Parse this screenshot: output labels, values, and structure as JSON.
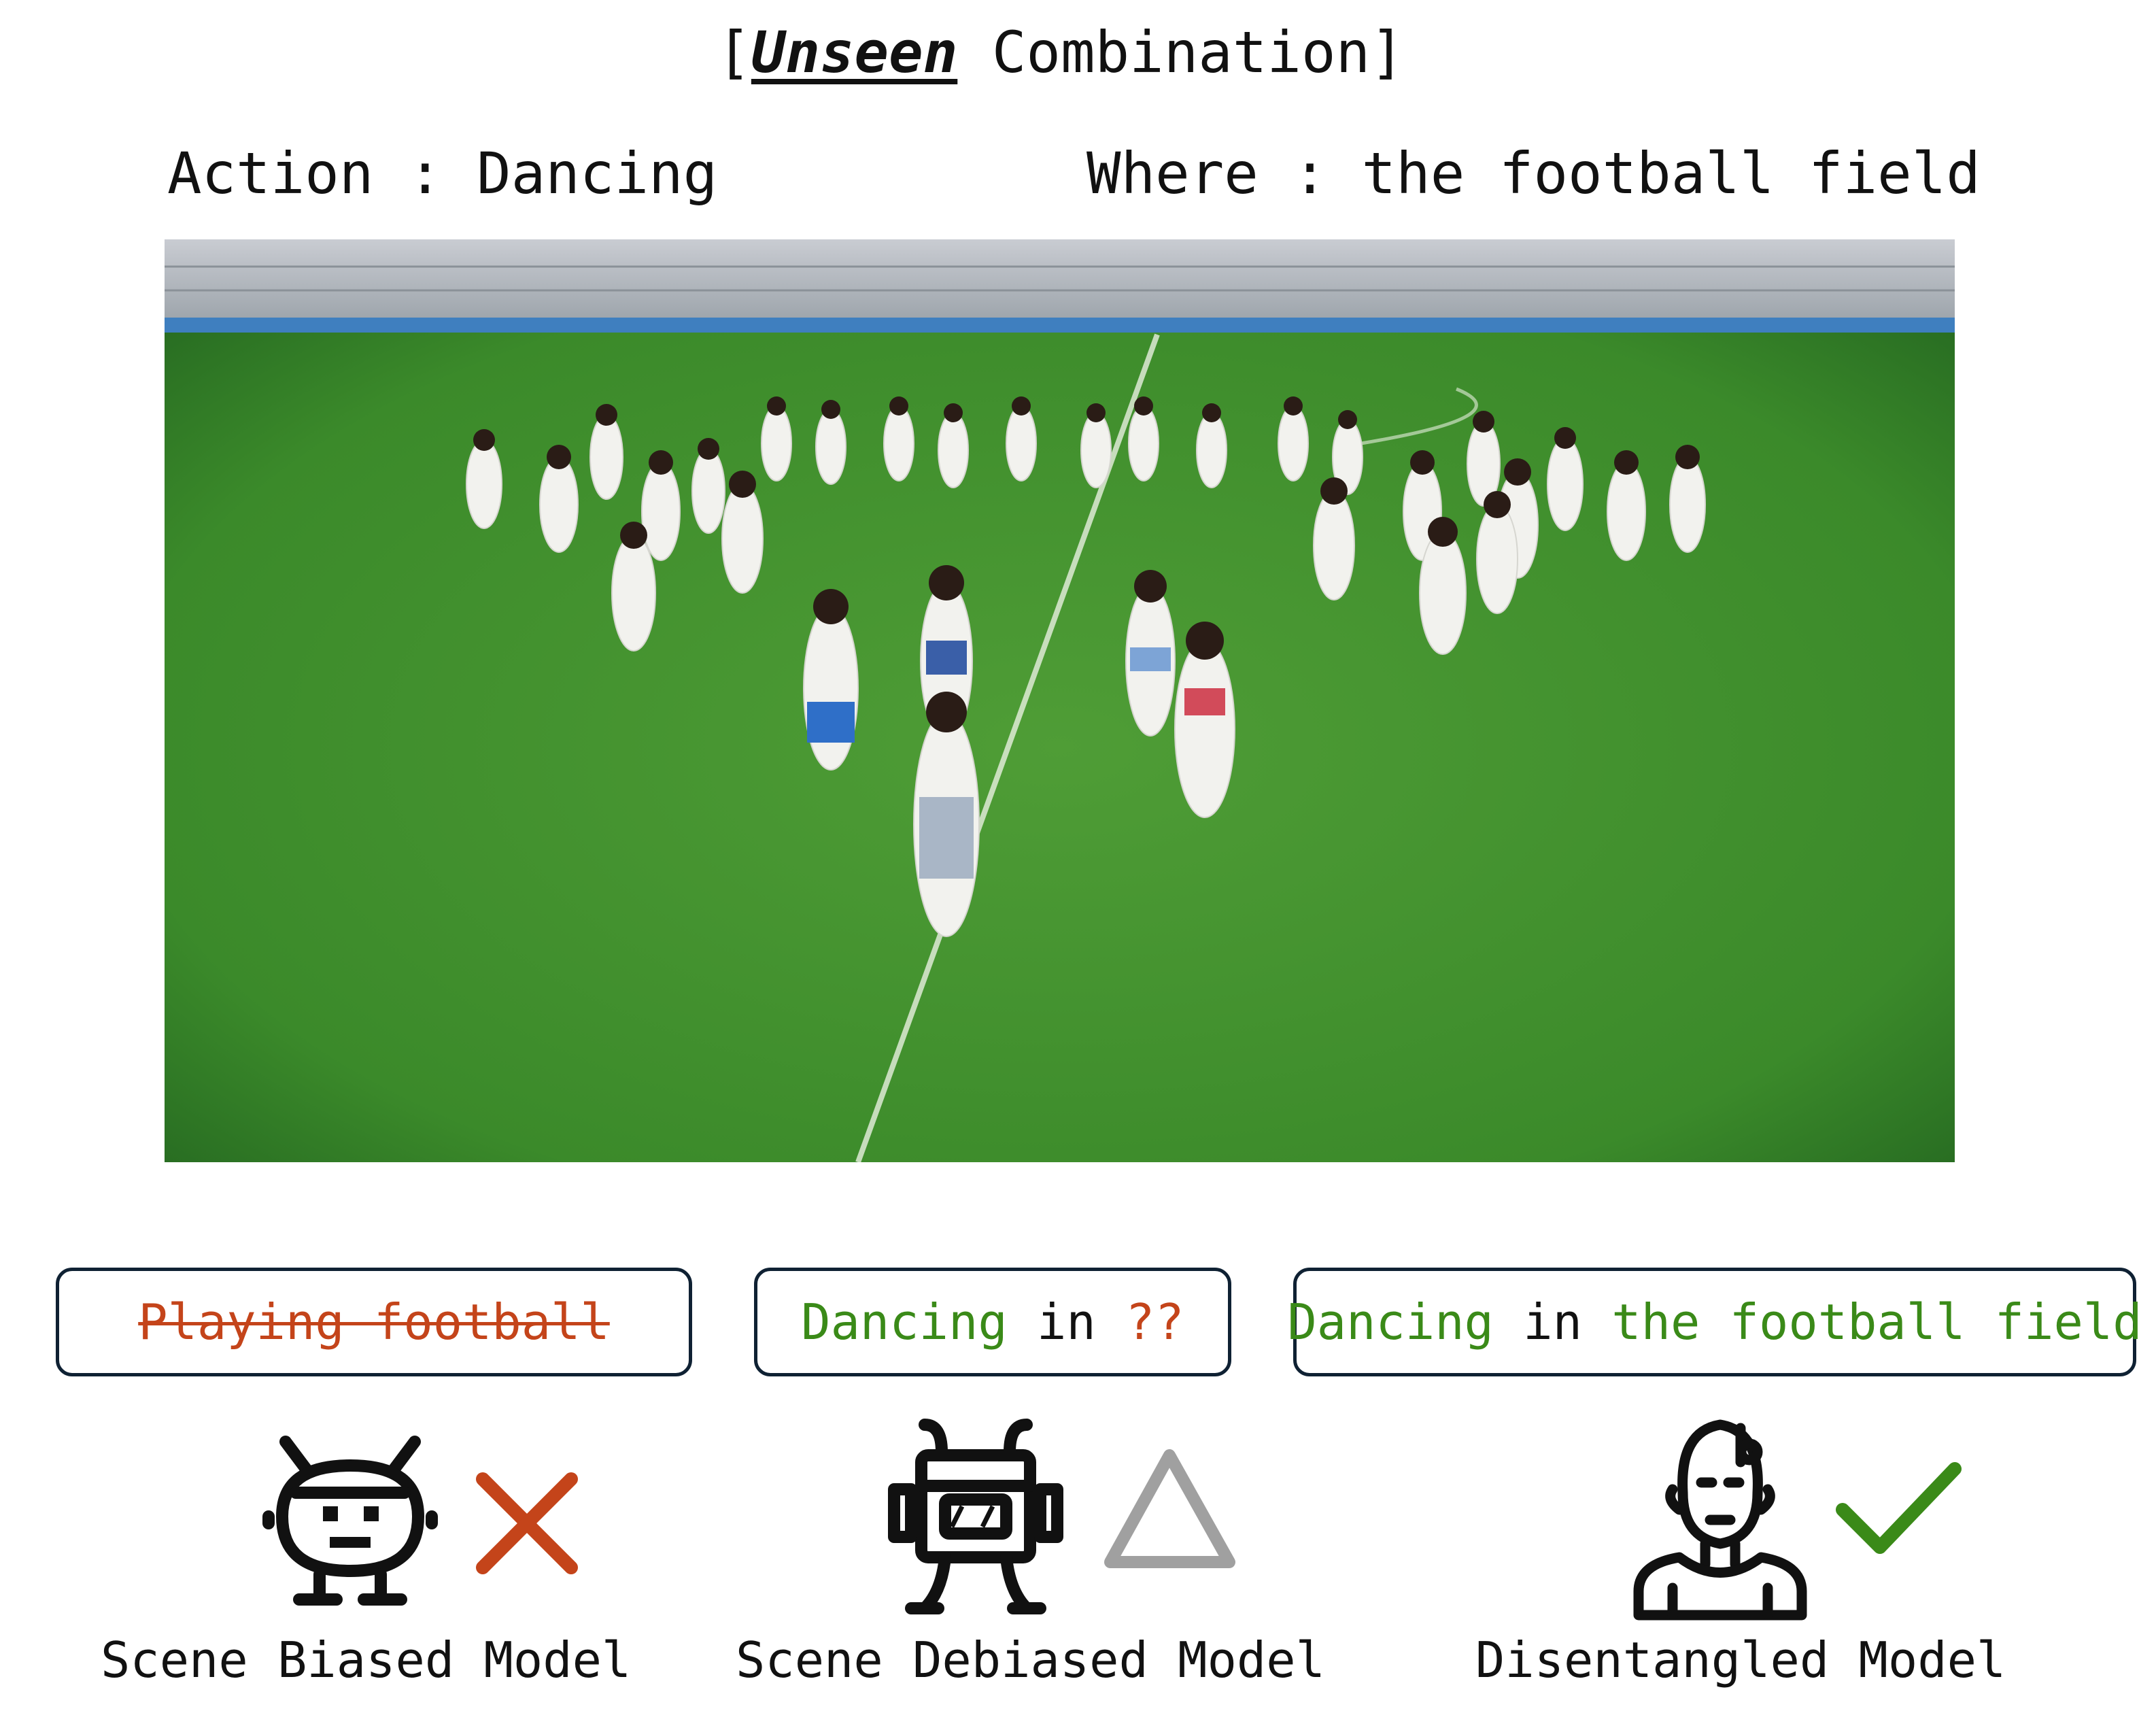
{
  "title": {
    "prefix": "[",
    "emphasis": "Unseen",
    "suffix": " Combination]"
  },
  "action_label": "Action : Dancing",
  "where_label": "Where : the football field",
  "predictions": [
    {
      "text_main": "Playing football",
      "text_mid": "",
      "text_end": ""
    },
    {
      "text_main": "Dancing",
      "text_mid": " in ",
      "text_end": "??"
    },
    {
      "text_main": "Dancing",
      "text_mid": " in ",
      "text_end": "the football field"
    }
  ],
  "models": [
    {
      "label": "Scene Biased Model",
      "icon": "robot-icon",
      "verdict": "cross-icon"
    },
    {
      "label": "Scene Debiased Model",
      "icon": "robot-antenna-icon",
      "verdict": "triangle-icon"
    },
    {
      "label": "Disentangled Model",
      "icon": "human-icon",
      "verdict": "checkmark-icon"
    }
  ],
  "colors": {
    "correct": "#3a8a18",
    "wrong": "#c4441a",
    "partial": "#a0a0a0",
    "box_border": "#0f2133"
  }
}
